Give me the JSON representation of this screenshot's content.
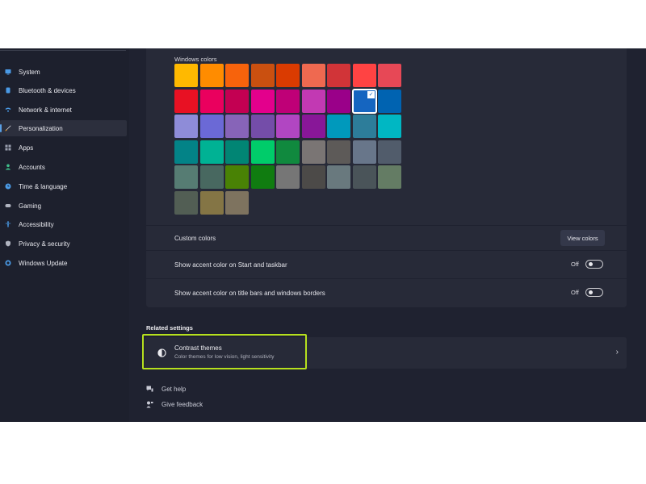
{
  "sidebar": {
    "items": [
      {
        "label": "System",
        "icon": "monitor-icon",
        "color": "#4a9ae6"
      },
      {
        "label": "Bluetooth & devices",
        "icon": "bluetooth-icon",
        "color": "#4a9ae6"
      },
      {
        "label": "Network & internet",
        "icon": "wifi-icon",
        "color": "#4a9ae6"
      },
      {
        "label": "Personalization",
        "icon": "brush-icon",
        "color": "#e8e8ee",
        "selected": true
      },
      {
        "label": "Apps",
        "icon": "apps-icon",
        "color": "#9aa0b0"
      },
      {
        "label": "Accounts",
        "icon": "person-icon",
        "color": "#3fbf8a"
      },
      {
        "label": "Time & language",
        "icon": "globe-clock-icon",
        "color": "#4a9ae6"
      },
      {
        "label": "Gaming",
        "icon": "gamepad-icon",
        "color": "#b0b4c0"
      },
      {
        "label": "Accessibility",
        "icon": "accessibility-icon",
        "color": "#4a9ae6"
      },
      {
        "label": "Privacy & security",
        "icon": "shield-icon",
        "color": "#b0b4c0"
      },
      {
        "label": "Windows Update",
        "icon": "update-icon",
        "color": "#4a9ae6"
      }
    ]
  },
  "colors_panel": {
    "windows_colors_label": "Windows colors",
    "selected_color": "#1565c0",
    "swatches": [
      [
        "#ffb900",
        "#ff8c00",
        "#f7630c",
        "#ca5010",
        "#da3b01",
        "#ef6950",
        "#d13438",
        "#ff4343",
        "#e74856"
      ],
      [
        "#e81123",
        "#ea005e",
        "#c30052",
        "#e3008c",
        "#bf0077",
        "#c239b3",
        "#9a0089",
        "#1565c0",
        "#0063b1"
      ],
      [
        "#8e8cd8",
        "#6b69d6",
        "#8764b8",
        "#744da9",
        "#b146c2",
        "#881798",
        "#0099bc",
        "#2d7d9a",
        "#00b7c3"
      ],
      [
        "#038387",
        "#00b294",
        "#018574",
        "#00cc6a",
        "#10893e",
        "#7a7574",
        "#5d5a58",
        "#68768a",
        "#515c6b"
      ],
      [
        "#567c73",
        "#486860",
        "#498205",
        "#107c10",
        "#767676",
        "#4c4a48",
        "#69797e",
        "#4a5459",
        "#647c64"
      ],
      [
        "#525e54",
        "#847545",
        "#7e735f"
      ]
    ],
    "custom_colors_label": "Custom colors",
    "view_colors_label": "View colors",
    "accent_start_label": "Show accent color on Start and taskbar",
    "accent_start_state": "Off",
    "accent_title_label": "Show accent color on title bars and windows borders",
    "accent_title_state": "Off"
  },
  "related": {
    "heading": "Related settings",
    "contrast_title": "Contrast themes",
    "contrast_subtitle": "Color themes for low vision, light sensitivity",
    "highlight_color": "#b6e01e"
  },
  "help": {
    "get_help": "Get help",
    "give_feedback": "Give feedback"
  }
}
